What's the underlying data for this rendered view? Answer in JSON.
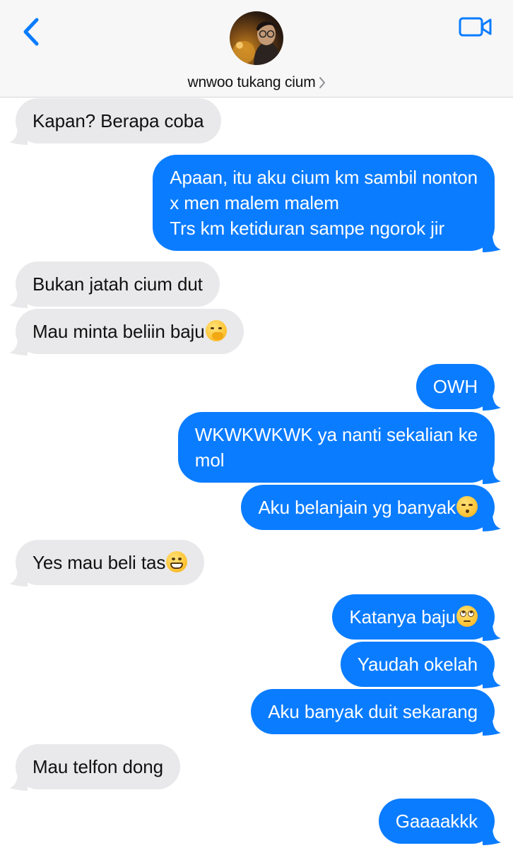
{
  "header": {
    "contact_name": "wnwoo tukang cium",
    "back_icon": "chevron-left-icon",
    "video_icon": "video-camera-icon",
    "accent_color": "#0a7cff"
  },
  "colors": {
    "incoming_bubble": "#e9e9eb",
    "outgoing_bubble": "#0a7cff"
  },
  "messages": [
    {
      "dir": "in",
      "lines": [
        "Kapan? Berapa coba"
      ]
    },
    {
      "dir": "out",
      "lines": [
        "Apaan, itu aku cium km sambil nonton",
        "x men malem malem",
        "Trs km ketiduran sampe ngorok jir"
      ]
    },
    {
      "dir": "in",
      "lines": [
        "Bukan jatah cium dut"
      ]
    },
    {
      "dir": "in",
      "lines": [
        "Mau minta beliin baju"
      ],
      "emoji": "hand-over-mouth-emoji"
    },
    {
      "dir": "out",
      "lines": [
        "OWH"
      ]
    },
    {
      "dir": "out",
      "lines": [
        "WKWKWKWK ya nanti sekalian ke",
        "mol"
      ]
    },
    {
      "dir": "out",
      "lines": [
        "Aku belanjain yg banyak"
      ],
      "emoji": "kissing-face-emoji"
    },
    {
      "dir": "in",
      "lines": [
        "Yes mau beli tas"
      ],
      "emoji": "grinning-face-emoji"
    },
    {
      "dir": "out",
      "lines": [
        "Katanya baju"
      ],
      "emoji": "rolling-eyes-emoji"
    },
    {
      "dir": "out",
      "lines": [
        "Yaudah okelah"
      ]
    },
    {
      "dir": "out",
      "lines": [
        "Aku banyak duit sekarang"
      ]
    },
    {
      "dir": "in",
      "lines": [
        "Mau telfon dong"
      ]
    },
    {
      "dir": "out",
      "lines": [
        "Gaaaakkk"
      ]
    }
  ]
}
